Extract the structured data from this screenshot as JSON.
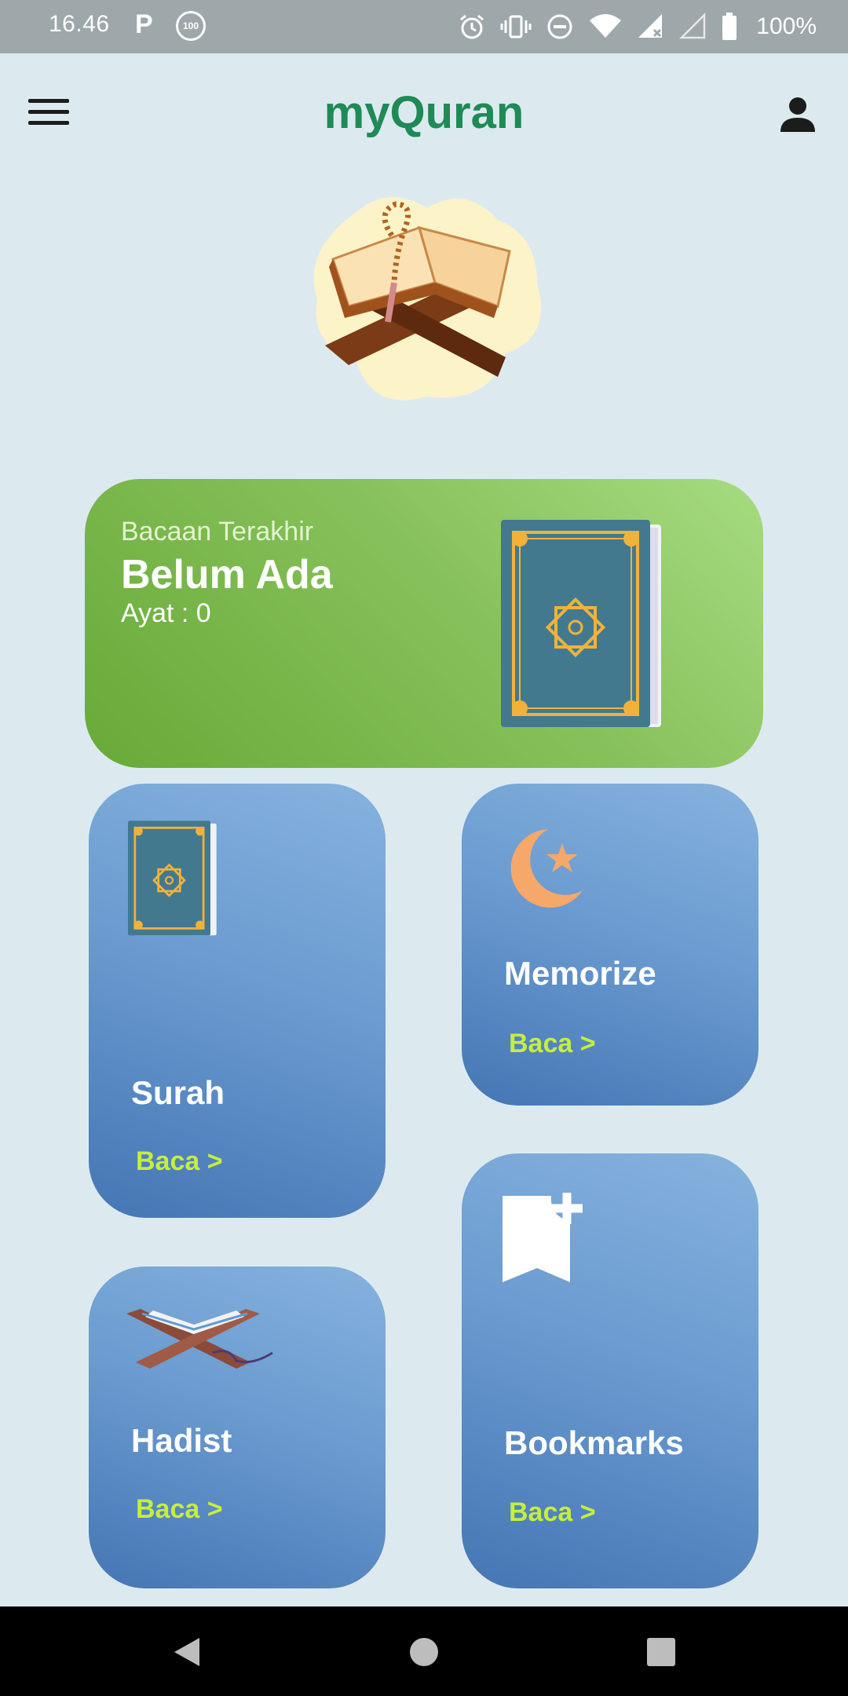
{
  "status_bar": {
    "time": "16.46",
    "notif_p": "P",
    "notif_badge": "100",
    "battery": "100%",
    "icons": [
      "alarm-icon",
      "vibrate-icon",
      "do-not-disturb-icon",
      "wifi-icon",
      "signal-icon",
      "signal-empty-icon",
      "battery-icon"
    ]
  },
  "app_bar": {
    "title": "myQuran",
    "title_color": "#1f8a55"
  },
  "last_read": {
    "label": "Bacaan Terakhir",
    "title": "Belum Ada",
    "ayat": "Ayat : 0"
  },
  "cards": {
    "surah": {
      "title": "Surah",
      "link": "Baca >"
    },
    "memorize": {
      "title": "Memorize",
      "link": "Baca >"
    },
    "hadist": {
      "title": "Hadist",
      "link": "Baca >"
    },
    "bookmarks": {
      "title": "Bookmarks",
      "link": "Baca >"
    }
  },
  "colors": {
    "background": "#dceaf0",
    "last_read_gradient": [
      "#a6dc81",
      "#68aa38"
    ],
    "card_gradient": [
      "#86b2de",
      "#4576b4"
    ],
    "link": "#c6ee3e"
  }
}
